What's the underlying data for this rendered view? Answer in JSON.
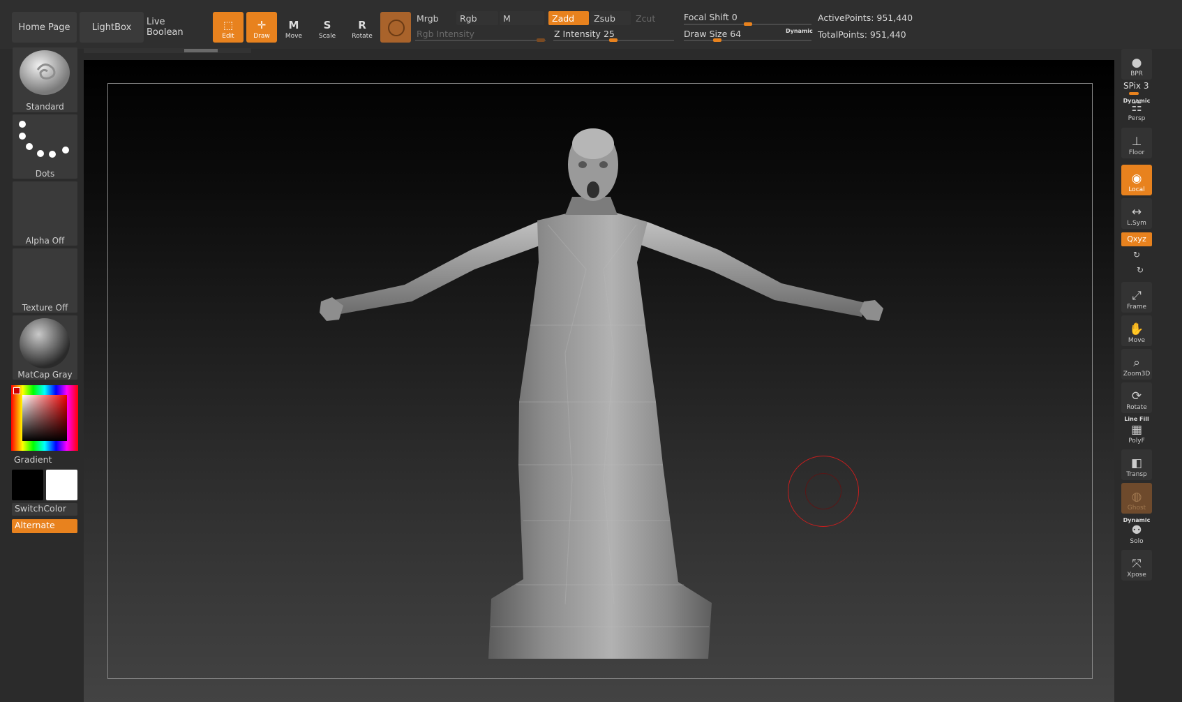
{
  "nav": {
    "home": "Home Page",
    "lightbox": "LightBox",
    "live_boolean": "Live Boolean"
  },
  "tools": [
    {
      "label": "Edit",
      "icon": "edit-icon",
      "active": true
    },
    {
      "label": "Draw",
      "icon": "draw-icon",
      "active": true
    },
    {
      "label": "Move",
      "icon": "move-icon",
      "active": false
    },
    {
      "label": "Scale",
      "icon": "scale-icon",
      "active": false
    },
    {
      "label": "Rotate",
      "icon": "rotate-icon",
      "active": false
    }
  ],
  "color_modes": {
    "mrgb": "Mrgb",
    "rgb": "Rgb",
    "m": "M"
  },
  "rgb_intensity": {
    "label": "Rgb Intensity"
  },
  "depth_modes": {
    "zadd": "Zadd",
    "zsub": "Zsub",
    "zcut": "Zcut"
  },
  "z_intensity": {
    "label": "Z Intensity",
    "value": "25"
  },
  "focal_shift": {
    "label": "Focal Shift",
    "value": "0"
  },
  "draw_size": {
    "label": "Draw Size",
    "value": "64",
    "tag": "Dynamic"
  },
  "stats": {
    "active_points": "ActivePoints: 951,440",
    "total_points": "TotalPoints: 951,440"
  },
  "left": {
    "brush": "Standard",
    "stroke": "Dots",
    "alpha": "Alpha Off",
    "texture": "Texture Off",
    "material": "MatCap Gray",
    "gradient": "Gradient",
    "switch_color": "SwitchColor",
    "alternate": "Alternate"
  },
  "right": {
    "bpr": "BPR",
    "spix": "SPix 3",
    "dynamic_tag": "Dynamic",
    "persp": "Persp",
    "floor": "Floor",
    "local": "Local",
    "lsym": "L.Sym",
    "xyz": "Qxyz",
    "frame": "Frame",
    "move": "Move",
    "zoom3d": "Zoom3D",
    "rotate": "Rotate",
    "linefill_tag": "Line Fill",
    "polyf": "PolyF",
    "transp": "Transp",
    "ghost": "Ghost",
    "dynamic_tag2": "Dynamic",
    "solo": "Solo",
    "xpose": "Xpose"
  },
  "colors": {
    "accent": "#e8821e",
    "panel": "#2b2b2b",
    "button": "#3a3a3a",
    "brush_ring": "#c81e1e"
  }
}
